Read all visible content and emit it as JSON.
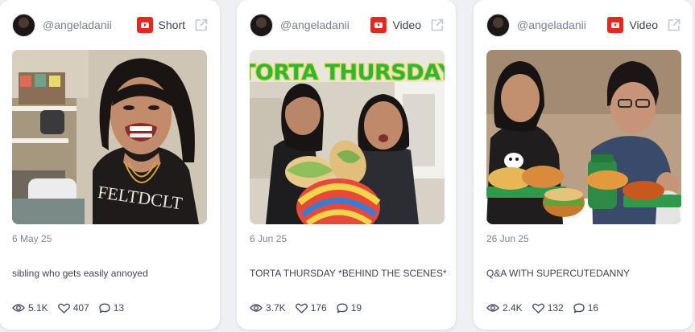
{
  "cards": [
    {
      "handle": "@angeladanii",
      "platform_icon": "youtube-icon",
      "type_label": "Short",
      "date": "6 May 25",
      "caption": "sibling who gets easily annoyed",
      "views": "5.1K",
      "likes": "407",
      "comments": "13"
    },
    {
      "handle": "@angeladanii",
      "platform_icon": "youtube-icon",
      "type_label": "Video",
      "date": "6 Jun 25",
      "caption": "TORTA THURSDAY *BEHIND THE SCENES*",
      "views": "3.7K",
      "likes": "176",
      "comments": "19",
      "thumbnail_text": "TORTA THURSDAY"
    },
    {
      "handle": "@angeladanii",
      "platform_icon": "youtube-icon",
      "type_label": "Video",
      "date": "26 Jun 25",
      "caption": "Q&A WITH SUPERCUTEDANNY",
      "views": "2.4K",
      "likes": "132",
      "comments": "16"
    }
  ],
  "colors": {
    "youtube_red": "#e3281e",
    "thumbnail_title_green": "#2ab83a",
    "thumbnail_title_yellow": "#f5d23a"
  }
}
